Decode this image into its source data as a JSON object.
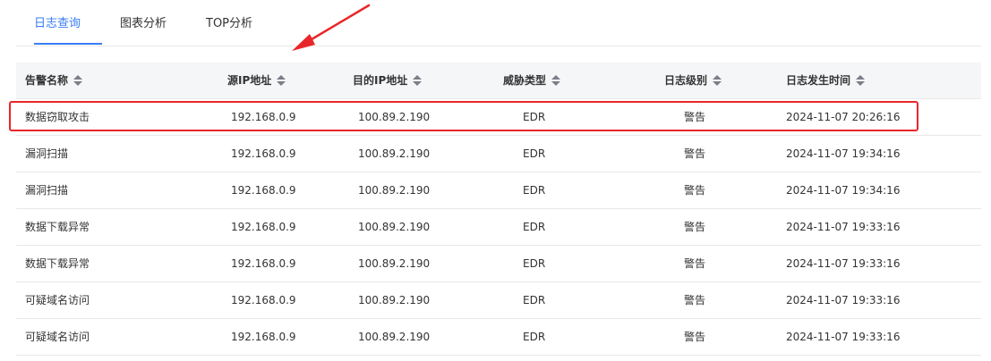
{
  "tabs": [
    {
      "label": "日志查询",
      "active": true
    },
    {
      "label": "图表分析",
      "active": false
    },
    {
      "label": "TOP分析",
      "active": false
    }
  ],
  "table": {
    "columns": [
      "告警名称",
      "源IP地址",
      "目的IP地址",
      "威胁类型",
      "日志级别",
      "日志发生时间"
    ],
    "rows": [
      [
        "数据窃取攻击",
        "192.168.0.9",
        "100.89.2.190",
        "EDR",
        "警告",
        "2024-11-07 20:26:16"
      ],
      [
        "漏洞扫描",
        "192.168.0.9",
        "100.89.2.190",
        "EDR",
        "警告",
        "2024-11-07 19:34:16"
      ],
      [
        "漏洞扫描",
        "192.168.0.9",
        "100.89.2.190",
        "EDR",
        "警告",
        "2024-11-07 19:34:16"
      ],
      [
        "数据下载异常",
        "192.168.0.9",
        "100.89.2.190",
        "EDR",
        "警告",
        "2024-11-07 19:33:16"
      ],
      [
        "数据下载异常",
        "192.168.0.9",
        "100.89.2.190",
        "EDR",
        "警告",
        "2024-11-07 19:33:16"
      ],
      [
        "可疑域名访问",
        "192.168.0.9",
        "100.89.2.190",
        "EDR",
        "警告",
        "2024-11-07 19:33:16"
      ],
      [
        "可疑域名访问",
        "192.168.0.9",
        "100.89.2.190",
        "EDR",
        "警告",
        "2024-11-07 19:33:16"
      ]
    ]
  },
  "colors": {
    "accent": "#3a7df5",
    "annotation": "#e8262a",
    "header_bg": "#f5f6f8",
    "border": "#e8e8e8"
  },
  "icons": {
    "sort": "sort-caret-icon",
    "annotation_arrow": "red-arrow-icon"
  }
}
